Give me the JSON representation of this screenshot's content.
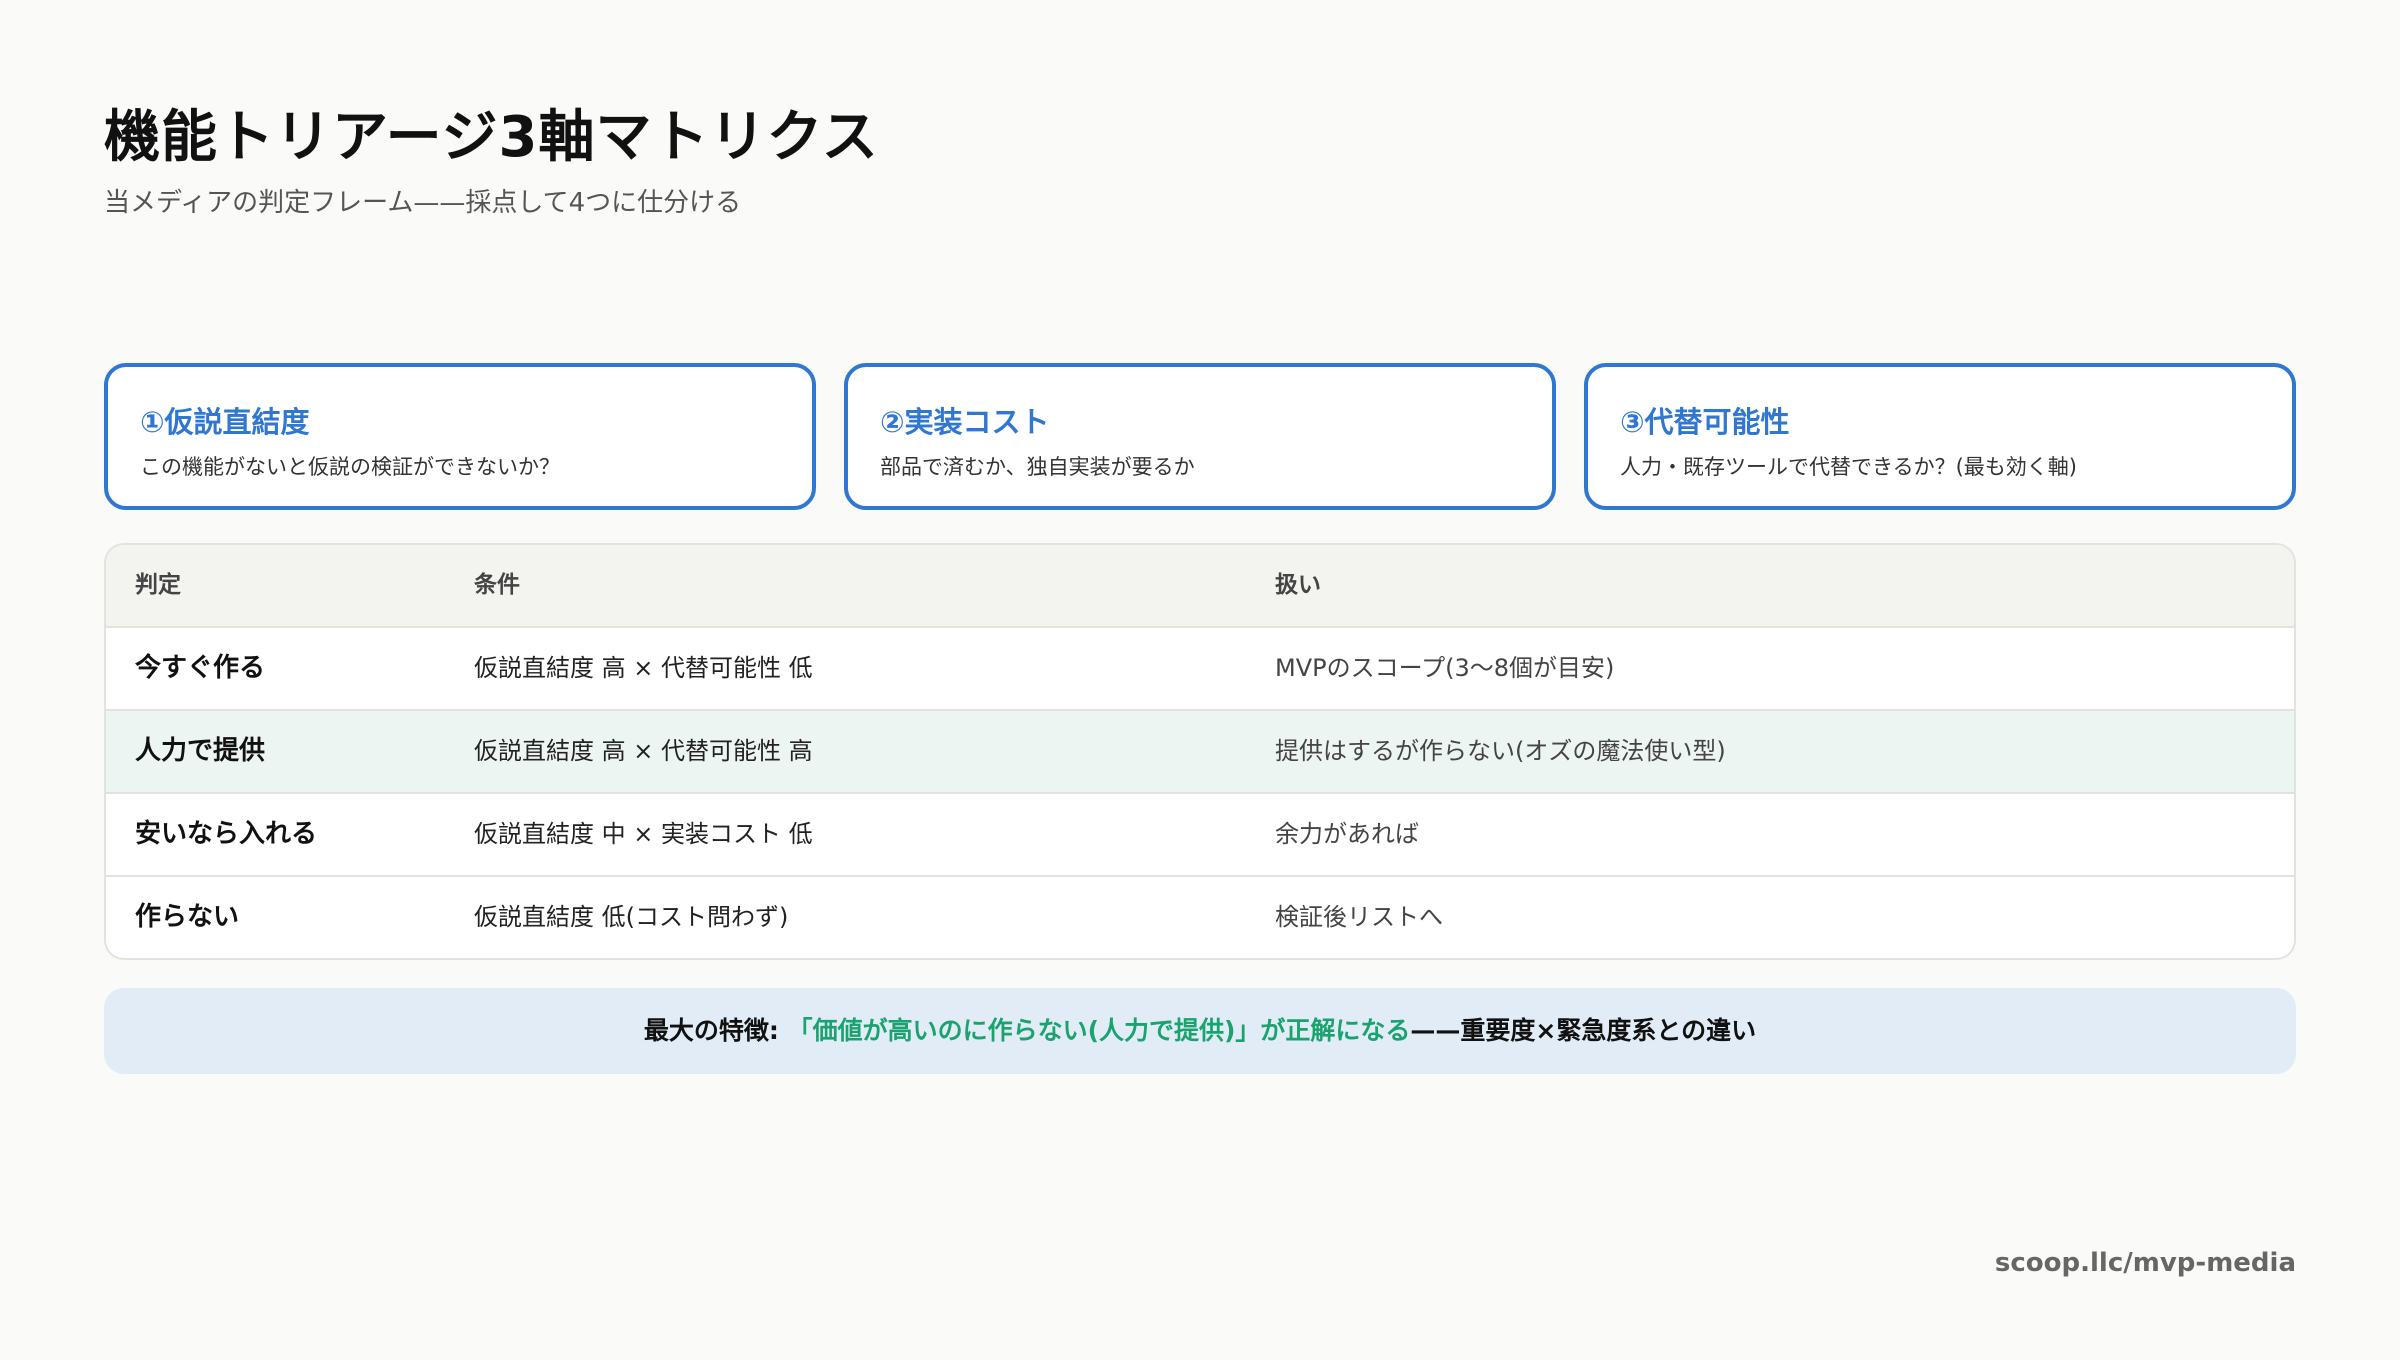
{
  "header": {
    "title": "機能トリアージ3軸マトリクス",
    "subtitle": "当メディアの判定フレーム——採点して4つに仕分ける"
  },
  "axes": [
    {
      "title": "①仮説直結度",
      "description": "この機能がないと仮説の検証ができないか？"
    },
    {
      "title": "②実装コスト",
      "description": "部品で済むか、独自実装が要るか"
    },
    {
      "title": "③代替可能性",
      "description": "人力・既存ツールで代替できるか？(最も効く軸)"
    }
  ],
  "table": {
    "headers": {
      "verdict": "判定",
      "condition": "条件",
      "handling": "扱い"
    },
    "rows": [
      {
        "verdict": "今すぐ作る",
        "condition": "仮説直結度 高 × 代替可能性 低",
        "handling": "MVPのスコープ(3〜8個が目安)"
      },
      {
        "verdict": "人力で提供",
        "condition": "仮説直結度 高 × 代替可能性 高",
        "handling": "提供はするが作らない(オズの魔法使い型)"
      },
      {
        "verdict": "安いなら入れる",
        "condition": "仮説直結度 中 × 実装コスト 低",
        "handling": "余力があれば"
      },
      {
        "verdict": "作らない",
        "condition": "仮説直結度 低(コスト問わず)",
        "handling": "検証後リストへ"
      }
    ]
  },
  "callout": {
    "prefix": "最大の特徴: ",
    "highlight": "「価値が高いのに作らない(人力で提供)」が正解になる",
    "suffix": "——重要度×緊急度系との違い"
  },
  "footer": {
    "url": "scoop.llc/mvp-media"
  },
  "colors": {
    "accent_blue": "#2f77d1",
    "highlight_green": "#1aa36f",
    "callout_bg": "#e2ecf7",
    "highlight_row_bg": "#edf5f2"
  }
}
